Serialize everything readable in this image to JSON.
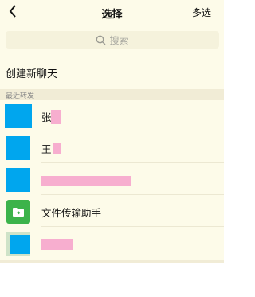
{
  "navbar": {
    "title": "选择",
    "action": "多选"
  },
  "search": {
    "placeholder": "搜索"
  },
  "new_chat": {
    "label": "创建新聊天"
  },
  "section": {
    "title": "最近转发"
  },
  "contacts": [
    {
      "name": "张"
    },
    {
      "name": "王"
    },
    {
      "name": ""
    },
    {
      "name": "文件传输助手"
    },
    {
      "name": ""
    }
  ],
  "colors": {
    "background": "#fdfbe9",
    "section_bar": "#f1ecd6",
    "avatar_blue": "#00a6ee",
    "file_helper_green": "#3cb34a",
    "redaction_pink": "#f7aecf"
  }
}
